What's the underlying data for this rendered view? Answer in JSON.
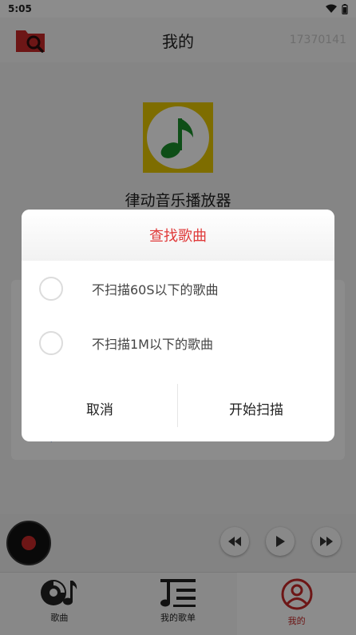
{
  "status_bar": {
    "time": "5:05"
  },
  "header": {
    "title": "我的",
    "user_id": "17370141"
  },
  "app": {
    "name": "律动音乐播放器"
  },
  "dialog": {
    "title": "查找歌曲",
    "options": [
      {
        "label": "不扫描60S以下的歌曲"
      },
      {
        "label": "不扫描1M以下的歌曲"
      }
    ],
    "cancel_label": "取消",
    "confirm_label": "开始扫描"
  },
  "bottom_nav": {
    "items": [
      {
        "label": "歌曲"
      },
      {
        "label": "我的歌单"
      },
      {
        "label": "我的"
      }
    ]
  },
  "colors": {
    "accent": "#e03a3a",
    "logo_bg": "#e6c600",
    "note": "#1a8f2a"
  }
}
